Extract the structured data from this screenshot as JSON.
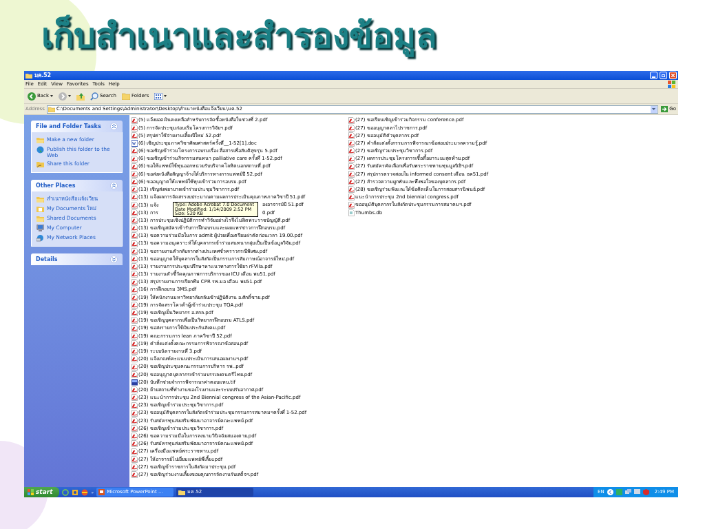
{
  "slide_title": "เก็บสำเนาและสำรองข้อมูล",
  "window": {
    "title": "มค.52",
    "menu": [
      "File",
      "Edit",
      "View",
      "Favorites",
      "Tools",
      "Help"
    ],
    "toolbar": [
      {
        "kind": "back",
        "label": "Back"
      },
      {
        "kind": "forward"
      },
      {
        "kind": "up"
      },
      {
        "kind": "search",
        "label": "Search"
      },
      {
        "kind": "folders",
        "label": "Folders"
      },
      {
        "kind": "views"
      }
    ],
    "address": {
      "label": "Address",
      "value": "C:\\Documents and Settings\\Administrator\\Desktop\\สำเนาหนังสือแจ้งเวียน\\มค.52",
      "go": "Go"
    }
  },
  "sidebar": [
    {
      "title": "File and Folder Tasks",
      "expanded": true,
      "items": [
        {
          "kind": "newfolder",
          "label": "Make a new folder"
        },
        {
          "kind": "globe",
          "label": "Publish this folder to the Web"
        },
        {
          "kind": "share",
          "label": "Share this folder"
        }
      ]
    },
    {
      "title": "Other Places",
      "expanded": true,
      "items": [
        {
          "kind": "folder",
          "label": "สำเนาหนังสือแจ้งเวียน"
        },
        {
          "kind": "mydocs",
          "label": "My Documents ใหม่"
        },
        {
          "kind": "folder",
          "label": "Shared Documents"
        },
        {
          "kind": "computer",
          "label": "My Computer"
        },
        {
          "kind": "network",
          "label": "My Network Places"
        }
      ]
    },
    {
      "title": "Details",
      "expanded": false
    }
  ],
  "file_columns": [
    [
      {
        "kind": "pdf",
        "name": "(5) แจ้งยอดเงินคงเหลือสำหรับการจัดซื้อหนังสือในช่วงที่ 2.pdf"
      },
      {
        "kind": "pdf",
        "name": "(5) การจัดประชุมก่อนเริ่มโครงการวิจัยฯ.pdf"
      },
      {
        "kind": "pdf",
        "name": "(5) สรุปค่าใช้จ่ายงานเลี้ยงปีใหม่ 52.pdf"
      },
      {
        "kind": "doc",
        "name": "(6) เชิญประชุมภาควิชาศัลยศาสตร์ครั้งที่__1-52[1].doc"
      },
      {
        "kind": "pdf",
        "name": "(6) ขอเชิญเข้าร่วมโครงการอบรมเรื่อง สื่อสารเพื่อสันติสุขรุ่น 5.pdf"
      },
      {
        "kind": "pdf",
        "name": "(6) ขอเชิญเข้าร่วมกิจกรรมสนทนา palliative care ครั้งที่ 1-52.pdf"
      },
      {
        "kind": "pdf",
        "name": "(6) ขอให้แพทย์ใช้ทุนออกหน่วยรับบริจาคโลหิตนอกสถานที่.pdf"
      },
      {
        "kind": "pdf",
        "name": "(6) ขอส่งหนังสือสัญญาจ้างให้บริการทางการแพทย์ปี 52.pdf"
      },
      {
        "kind": "pdf",
        "name": "(6) ขออนุญาตให้แพทย์ใช้ทุนเข้าร่วมการอบรม.pdf"
      },
      {
        "kind": "pdf",
        "name": "(13) เชิญส่งพยาบาลเข้าร่วมประชุมวิชาการ.pdf"
      },
      {
        "kind": "pdf",
        "name": "(13) แจ้งผลการจัดสรรงบประมาณตามผลการประเมินคุณภาพภาควิชาปี 51.pdf"
      },
      {
        "kind": "pdf",
        "name": "(13) แจ้ง",
        "name_after": "องอาจารย์ปี 51.pdf"
      },
      {
        "kind": "pdf",
        "name": "(13) การ",
        "name_after": "0.pdf"
      },
      {
        "kind": "pdf",
        "name": "(13) การประชุมเชิงปฏิบัติการทำวิจัยอย่างไรจึงไม่ผิดพระราชบัญญัติ.pdf"
      },
      {
        "kind": "pdf",
        "name": "(13) ขอเชิญสมัครเข้ารับการฝึกอบรมและเผยแพร่ข่าวการฝึกอบรม.pdf"
      },
      {
        "kind": "pdf",
        "name": "(13) ขอความร่วมมือในการ admit ผู้ป่วยเพื่อเตรียมผ่าตัดก่อนเวลา 19.00.pdf"
      },
      {
        "kind": "pdf",
        "name": "(13) ขอความอนุเคราะห์ให้บุคลากรเข้าร่วมสนทนากลุ่มเป็นเป็นข้อมูลวิจัย.pdf"
      },
      {
        "kind": "pdf",
        "name": "(13) ขอรายงานตัวกลับจากต่างประเทศชั่วคราวกรณีพิเศษ.pdf"
      },
      {
        "kind": "pdf",
        "name": "(13) ขออนุญาตให้บุคลากรในสังกัดเป็นกรรมการสัมภาษณ์อาจารย์ใหม่.pdf"
      },
      {
        "kind": "pdf",
        "name": "(13) รายงานการประชุมปรึกษาหาแนวทางการใช้ยา rFVIIa.pdf"
      },
      {
        "kind": "pdf",
        "name": "(13) รายงานตัวชี้วัดคุณภาพการบริการของ ICU เดือน พย51.pdf"
      },
      {
        "kind": "pdf",
        "name": "(13) สรุปรายงานการเรียกทีม CPR รพ.มอ เดือน พย51.pdf"
      },
      {
        "kind": "pdf",
        "name": "(16) การฝึกอบรม 3MS.pdf"
      },
      {
        "kind": "pdf",
        "name": "(19) ให้พนักงานมหาวิทยาลัยกลับเข้าปฏิบัติงาน อ.ศักดิ์ชาย.pdf"
      },
      {
        "kind": "pdf",
        "name": "(19) การจัดสรรโควต้าผู้เข้าร่วมประชุม TQA.pdf"
      },
      {
        "kind": "pdf",
        "name": "(19) ขอเชิญเป็นวิทยากร อ.สกล.pdf"
      },
      {
        "kind": "pdf",
        "name": "(19) ขอเชิญบุคลากรเพื่อเป็นวิทยากรฝึกอบรม ATLS.pdf"
      },
      {
        "kind": "pdf",
        "name": "(19) ขอส่งรายการใช้เงินประกันสังคม.pdf"
      },
      {
        "kind": "pdf",
        "name": "(19) คณะกรรมการ lean ภาควิชาปี 52.pdf"
      },
      {
        "kind": "pdf",
        "name": "(19) คำสั่งแต่งตั้งคณะกรรมการพิจารณาข้อสอบ.pdf"
      },
      {
        "kind": "pdf",
        "name": "(19) ระบบนัดรายงานที่ 3.pdf"
      },
      {
        "kind": "pdf",
        "name": "(20) แจ้งเกณฑ์คะแนนประเมินการเสนอผลงานฯ.pdf"
      },
      {
        "kind": "pdf",
        "name": "(20) ขอเชิญประชุมคณะกรรมการบริหาร รพ..pdf"
      },
      {
        "kind": "pdf",
        "name": "(20) ขออนุญาตบุคลากรเข้าร่วมบรรเลงดนตรีไทย.pdf"
      },
      {
        "kind": "tif",
        "name": "(20) บันทึกช่วยจำการพิจารณาค่าตอบแทน.tif"
      },
      {
        "kind": "pdf",
        "name": "(20) ย้ายสถานที่ทำงานของโรงงานและระบบปรับอากาศ.pdf"
      },
      {
        "kind": "pdf",
        "name": "(23) แนะนำการประชุม 2nd Biennial congress of the Asian-Pacific.pdf"
      },
      {
        "kind": "pdf",
        "name": "(23) ขอเชิญเข้าร่วมประชุมวิชาการ.pdf"
      },
      {
        "kind": "pdf",
        "name": "(23) ขออนุมัติบุคลากรในสังกัดเข้าร่วมประชุมกรรมการสมาคมฯครั้งที่ 1-52.pdf"
      },
      {
        "kind": "pdf",
        "name": "(23) รับสมัครทุนส่งเสริมพัฒนาอาจารย์คณะแพทย์.pdf"
      },
      {
        "kind": "pdf",
        "name": "(26) ขอเชิญเข้าร่วมประชุมวิชาการ.pdf"
      },
      {
        "kind": "pdf",
        "name": "(26) ขอความร่วมมือในการลงนามวินิจฉัยสมองตาย.pdf"
      },
      {
        "kind": "pdf",
        "name": "(26) รับสมัครทุนส่งเสริมพัฒนาอาจารย์คณะแพทย์.pdf"
      },
      {
        "kind": "pdf",
        "name": "(27) เครื่องมือแพทย์พระราชทาน.pdf"
      },
      {
        "kind": "pdf",
        "name": "(27) ให้อาจารย์ไปเยี่ยมแพทย์พี่เลี้ยง.pdf"
      },
      {
        "kind": "pdf",
        "name": "(27) ขอเชิญข้าราชการในสังกัดมาประชุม.pdf"
      },
      {
        "kind": "pdf",
        "name": "(27) ขอเชิญร่วมงานเลี้ยงขอบคุณการจัดงานรับเสด็จฯ.pdf"
      }
    ],
    [
      {
        "kind": "pdf",
        "name": "(27) ขอเรียนเชิญเข้าร่วมกิจกรรม conference.pdf"
      },
      {
        "kind": "pdf",
        "name": "(27) ขออนุญาตลาไปราชการ.pdf"
      },
      {
        "kind": "pdf",
        "name": "(27) ขออนุมัติตัวบุคลากร.pdf"
      },
      {
        "kind": "pdf",
        "name": "(27) คำสั่งแต่งตั้งกรรมการพิจารณาข้อสอบประมวลความรู้.pdf"
      },
      {
        "kind": "pdf",
        "name": "(27) ขอเชิญร่วมประชุมวิชาการ.pdf"
      },
      {
        "kind": "pdf",
        "name": "(27) ผลการประชุมโครงการเชื้อดื้อยาระยะสุดท้าย.pdf"
      },
      {
        "kind": "pdf",
        "name": "(27) รับสมัครคัดเลือกเพื่อรับพระราชทานทุนมูลนิธิฯ.pdf"
      },
      {
        "kind": "pdf",
        "name": "(27) สรุปการตรวจสอบใน informed consent เดือน ธค51.pdf"
      },
      {
        "kind": "pdf",
        "name": "(27) สำรวจความผูกพันและพึงพอใจของบุคลากร.pdf"
      },
      {
        "kind": "pdf",
        "name": "(28) ขอเชิญร่วมฟังและให้ข้อคิดเห็นในการสอบสารนิพนธ์.pdf"
      },
      {
        "kind": "pdf",
        "name": "แนะนำการประชุม 2nd biennial congress.pdf"
      },
      {
        "kind": "pdf",
        "name": "ขออนุมัติบุคลากรในสังกัดประชุมกรรมการสมาคมฯ.pdf"
      },
      {
        "kind": "db",
        "name": "Thumbs.db"
      }
    ]
  ],
  "tooltip": [
    "Type: Adobe Acrobat 7.0 Document",
    "Date Modified: 1/14/2009 2:52 PM",
    "Size: 520 KB"
  ],
  "taskbar": {
    "start": "start",
    "overflow": "»",
    "tasks": [
      {
        "kind": "powerpoint",
        "label": "Microsoft PowerPoint ...",
        "selected": false
      },
      {
        "kind": "folder",
        "label": "มค.52",
        "selected": true
      }
    ],
    "language": "EN",
    "clock": "2:49 PM"
  }
}
